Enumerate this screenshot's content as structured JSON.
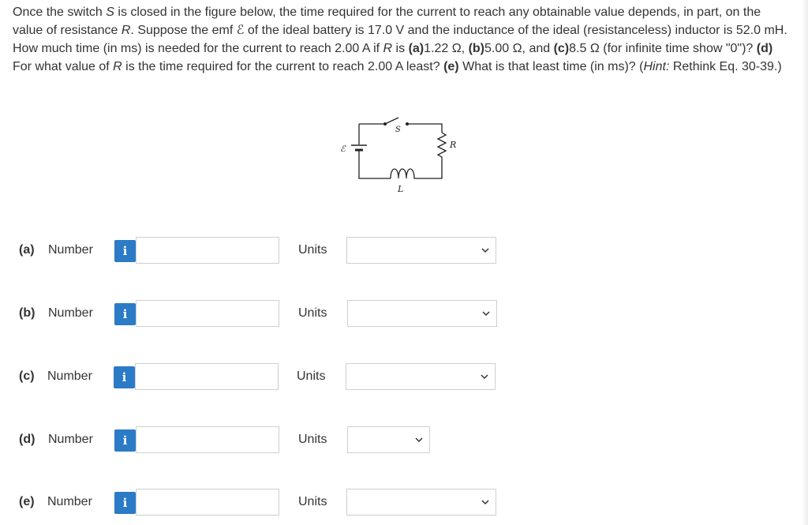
{
  "question": {
    "p1": "Once the switch ",
    "s_var": "S",
    "p2": " is closed in the figure below, the time required for the current to reach any obtainable value depends, in part, on the value of resistance ",
    "r_var": "R",
    "p3": ". Suppose the emf ",
    "emf_symbol": "ℰ",
    "p4": " of the ideal battery is 17.0 V and the inductance of the ideal (resistanceless) inductor is 52.0 mH. How much time (in ms) is needed for the current to reach 2.00 A if ",
    "r_var2": "R",
    "p5": " is ",
    "a_tag": "(a)",
    "a_val": "1.22 Ω, ",
    "b_tag": "(b)",
    "b_val": "5.00 Ω, and ",
    "c_tag": "(c)",
    "c_val": "8.5 Ω (for infinite time show \"0\")? ",
    "d_tag": "(d)",
    "d_text1": " For what value of ",
    "r_var3": "R",
    "d_text2": " is the time required for the current to reach 2.00 A least? ",
    "e_tag": "(e)",
    "e_text": " What is that least time (in ms)? (",
    "hint": "Hint:",
    "hint_text": " Rethink Eq. 30-39.)"
  },
  "figure": {
    "emf_label": "ℰ",
    "switch_label": "S",
    "resistor_label": "R",
    "inductor_label": "L"
  },
  "parts": [
    {
      "tag": "(a)",
      "label": "Number",
      "value": "",
      "units_label": "Units",
      "units_value": ""
    },
    {
      "tag": "(b)",
      "label": "Number",
      "value": "",
      "units_label": "Units",
      "units_value": ""
    },
    {
      "tag": "(c)",
      "label": "Number",
      "value": "",
      "units_label": "Units",
      "units_value": ""
    },
    {
      "tag": "(d)",
      "label": "Number",
      "value": "",
      "units_label": "Units",
      "units_value": ""
    },
    {
      "tag": "(e)",
      "label": "Number",
      "value": "",
      "units_label": "Units",
      "units_value": ""
    }
  ],
  "info_glyph": "i",
  "icons": {
    "info": "info-icon",
    "dropdown": "chevron-down-icon"
  },
  "colors": {
    "info_button": "#2b7bc6",
    "text": "#333333",
    "border": "#cfcfcf"
  }
}
